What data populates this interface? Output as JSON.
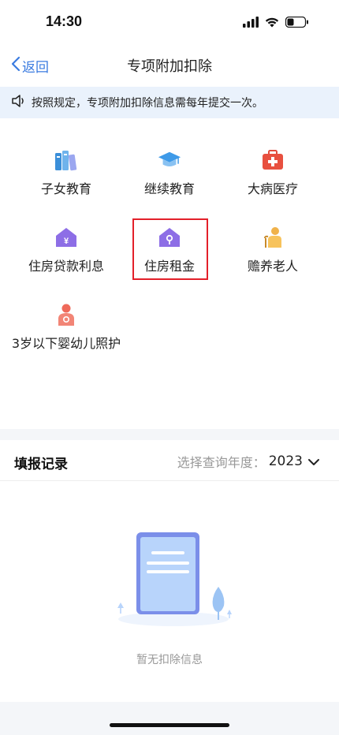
{
  "status_bar": {
    "time": "14:30"
  },
  "nav": {
    "back_label": "返回",
    "title": "专项附加扣除"
  },
  "notice": {
    "text": "按照规定，专项附加扣除信息需每年提交一次。"
  },
  "deductions": [
    {
      "label": "子女教育",
      "icon": "books-icon"
    },
    {
      "label": "继续教育",
      "icon": "graduation-cap-icon"
    },
    {
      "label": "大病医疗",
      "icon": "medical-kit-icon"
    },
    {
      "label": "住房贷款利息",
      "icon": "house-yuan-icon"
    },
    {
      "label": "住房租金",
      "icon": "house-key-icon"
    },
    {
      "label": "赡养老人",
      "icon": "elderly-person-icon"
    },
    {
      "label": "3岁以下婴幼儿照护",
      "icon": "mother-baby-icon"
    }
  ],
  "records": {
    "title": "填报记录",
    "year_prompt": "选择查询年度：",
    "year_value": "2023",
    "empty_text": "暂无扣除信息"
  },
  "colors": {
    "accent": "#3a7be0",
    "highlight": "#e3202a",
    "notice_bg": "#eaf2fc"
  }
}
